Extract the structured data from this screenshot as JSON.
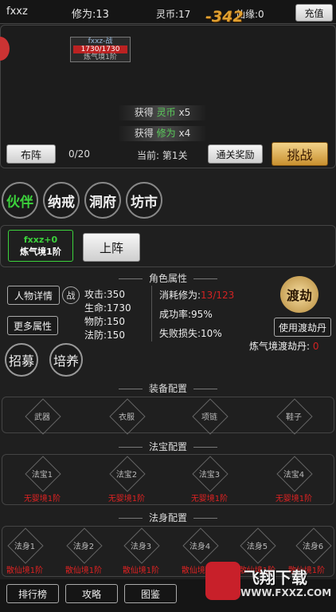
{
  "top": {
    "name": "fxxz",
    "cultivation": "修为:13",
    "spirit": "灵币:17",
    "fairy": "仙缘:0",
    "recharge": "充值",
    "damage": "-342"
  },
  "battle": {
    "unit_name": "fxxz-战",
    "hp": "1730/1730",
    "realm": "炼气境1阶",
    "gains": [
      {
        "prefix": "获得",
        "item": "灵币",
        "suffix": "x5"
      },
      {
        "prefix": "获得",
        "item": "修为",
        "suffix": "x4"
      }
    ]
  },
  "formation": {
    "label": "布阵",
    "count": "0/20",
    "current": "当前: 第1关",
    "reward": "通关奖励",
    "challenge": "挑战"
  },
  "tabs": [
    "伙伴",
    "纳戒",
    "洞府",
    "坊市"
  ],
  "partner": {
    "name": "fxxz+0",
    "realm": "炼气境1阶",
    "deploy": "上阵"
  },
  "attr": {
    "title": "角色属性",
    "detail": "人物详情",
    "battle": "战",
    "more": "更多属性",
    "recruit": "招募",
    "train": "培养",
    "atk": "攻击:350",
    "hp": "生命:1730",
    "pdef": "物防:150",
    "mdef": "法防:150",
    "cost_label": "消耗修为:",
    "cost_value": "13/123",
    "success": "成功率:95%",
    "fail": "失败损失:10%",
    "tribulation_icon": "渡劫",
    "use_pill": "使用渡劫丹",
    "pill_label": "炼气境渡劫丹:",
    "pill_count": "0"
  },
  "equip": {
    "title": "装备配置",
    "slots": [
      "武器",
      "衣服",
      "项链",
      "鞋子"
    ]
  },
  "treasure": {
    "title": "法宝配置",
    "slots": [
      "法宝1",
      "法宝2",
      "法宝3",
      "法宝4"
    ],
    "req": [
      "无婴境1阶",
      "无婴境1阶",
      "无婴境1阶",
      "无婴境1阶"
    ]
  },
  "body": {
    "title": "法身配置",
    "slots": [
      "法身1",
      "法身2",
      "法身3",
      "法身4",
      "法身5",
      "法身6"
    ],
    "req": [
      "散仙境1阶",
      "散仙境1阶",
      "散仙境1阶",
      "散仙境1阶",
      "散仙境1阶",
      "散仙境1阶"
    ]
  },
  "bottom": {
    "rank": "排行榜",
    "guide": "攻略",
    "atlas": "图鉴",
    "watermark": "飞翔下载",
    "url": "WWW.FXXZ.COM"
  },
  "colors": {
    "green": "#3cd23c",
    "red": "#d22222",
    "gold": "#e0a030"
  }
}
